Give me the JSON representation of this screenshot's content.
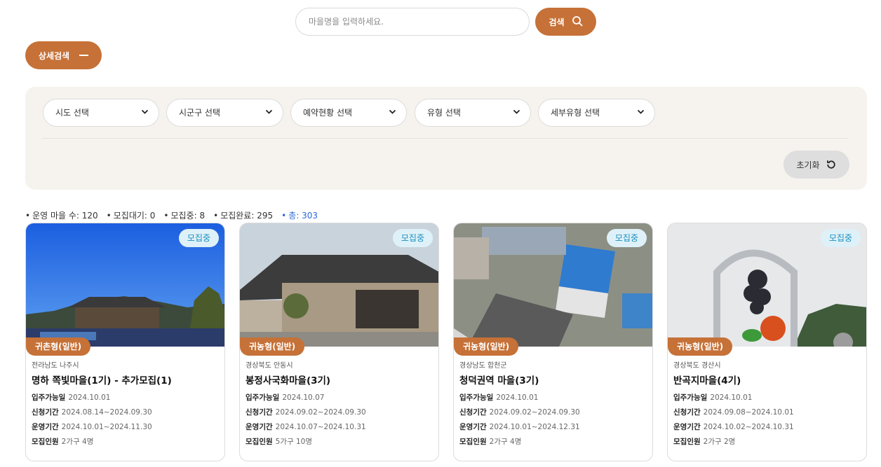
{
  "search": {
    "placeholder": "마을명을 입력하세요.",
    "button_label": "검색"
  },
  "detail_search": {
    "label": "상세검색"
  },
  "filters": {
    "selects": [
      "시도 선택",
      "시군구 선택",
      "예약현황 선택",
      "유형 선택",
      "세부유형 선택"
    ],
    "reset_label": "초기화"
  },
  "stats": {
    "operating": "운영 마을 수: 120",
    "waiting": "모집대기: 0",
    "recruiting": "모집중: 8",
    "completed": "모집완료: 295",
    "total": "총: 303"
  },
  "cards": [
    {
      "status": "모집중",
      "type": "귀촌형(일반)",
      "region": "전라남도 나주시",
      "title": "명하 쪽빛마을(1기) - 추가모집(1)",
      "move_in_label": "입주가능일",
      "move_in": "2024.10.01",
      "apply_label": "신청기간",
      "apply": "2024.08.14~2024.09.30",
      "operate_label": "운영기간",
      "operate": "2024.10.01~2024.11.30",
      "recruit_label": "모집인원",
      "recruit": "2가구 4명"
    },
    {
      "status": "모집중",
      "type": "귀농형(일반)",
      "region": "경상북도 안동시",
      "title": "봉정사국화마을(3기)",
      "move_in_label": "입주가능일",
      "move_in": "2024.10.07",
      "apply_label": "신청기간",
      "apply": "2024.09.02~2024.09.30",
      "operate_label": "운영기간",
      "operate": "2024.10.07~2024.10.31",
      "recruit_label": "모집인원",
      "recruit": "5가구 10명"
    },
    {
      "status": "모집중",
      "type": "귀농형(일반)",
      "region": "경상남도 합천군",
      "title": "청덕권역 마을(3기)",
      "move_in_label": "입주가능일",
      "move_in": "2024.10.01",
      "apply_label": "신청기간",
      "apply": "2024.09.02~2024.09.30",
      "operate_label": "운영기간",
      "operate": "2024.10.01~2024.12.31",
      "recruit_label": "모집인원",
      "recruit": "2가구 4명"
    },
    {
      "status": "모집중",
      "type": "귀농형(일반)",
      "region": "경상북도 경산시",
      "title": "반곡지마을(4기)",
      "move_in_label": "입주가능일",
      "move_in": "2024.10.01",
      "apply_label": "신청기간",
      "apply": "2024.09.08~2024.10.01",
      "operate_label": "운영기간",
      "operate": "2024.10.02~2024.10.31",
      "recruit_label": "모집인원",
      "recruit": "2가구 2명"
    }
  ],
  "colors": {
    "accent": "#c67137",
    "status_bg": "#dff1f8",
    "status_text": "#1a8fbf",
    "panel_bg": "#f6f3ee",
    "total_text": "#2b6bd6"
  }
}
